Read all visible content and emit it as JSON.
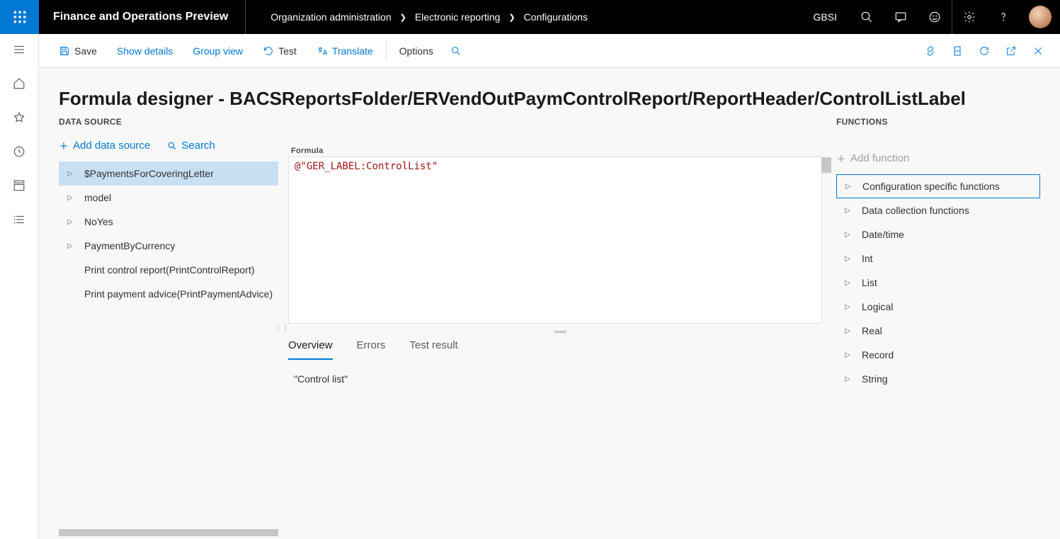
{
  "header": {
    "app_title": "Finance and Operations Preview",
    "breadcrumbs": [
      "Organization administration",
      "Electronic reporting",
      "Configurations"
    ],
    "company": "GBSI"
  },
  "cmdbar": {
    "save": "Save",
    "show_details": "Show details",
    "group_view": "Group view",
    "test": "Test",
    "translate": "Translate",
    "options": "Options"
  },
  "page_title": "Formula designer - BACSReportsFolder/ERVendOutPaymControlReport/ReportHeader/ControlListLabel",
  "datasource": {
    "label": "Data source",
    "add": "Add data source",
    "search": "Search",
    "items": [
      {
        "label": "$PaymentsForCoveringLetter",
        "expandable": true,
        "selected": true
      },
      {
        "label": "model",
        "expandable": true,
        "selected": false
      },
      {
        "label": "NoYes",
        "expandable": true,
        "selected": false
      },
      {
        "label": "PaymentByCurrency",
        "expandable": true,
        "selected": false
      },
      {
        "label": "Print control report(PrintControlReport)",
        "expandable": false,
        "selected": false
      },
      {
        "label": "Print payment advice(PrintPaymentAdvice)",
        "expandable": false,
        "selected": false
      }
    ]
  },
  "formula": {
    "label": "Formula",
    "expression": "@\"GER_LABEL:ControlList\""
  },
  "tabs": {
    "overview": "Overview",
    "errors": "Errors",
    "test_result": "Test result"
  },
  "overview_result": "\"Control list\"",
  "functions": {
    "label": "Functions",
    "add": "Add function",
    "items": [
      {
        "label": "Configuration specific functions",
        "selected": true
      },
      {
        "label": "Data collection functions",
        "selected": false
      },
      {
        "label": "Date/time",
        "selected": false
      },
      {
        "label": "Int",
        "selected": false
      },
      {
        "label": "List",
        "selected": false
      },
      {
        "label": "Logical",
        "selected": false
      },
      {
        "label": "Real",
        "selected": false
      },
      {
        "label": "Record",
        "selected": false
      },
      {
        "label": "String",
        "selected": false
      }
    ]
  }
}
